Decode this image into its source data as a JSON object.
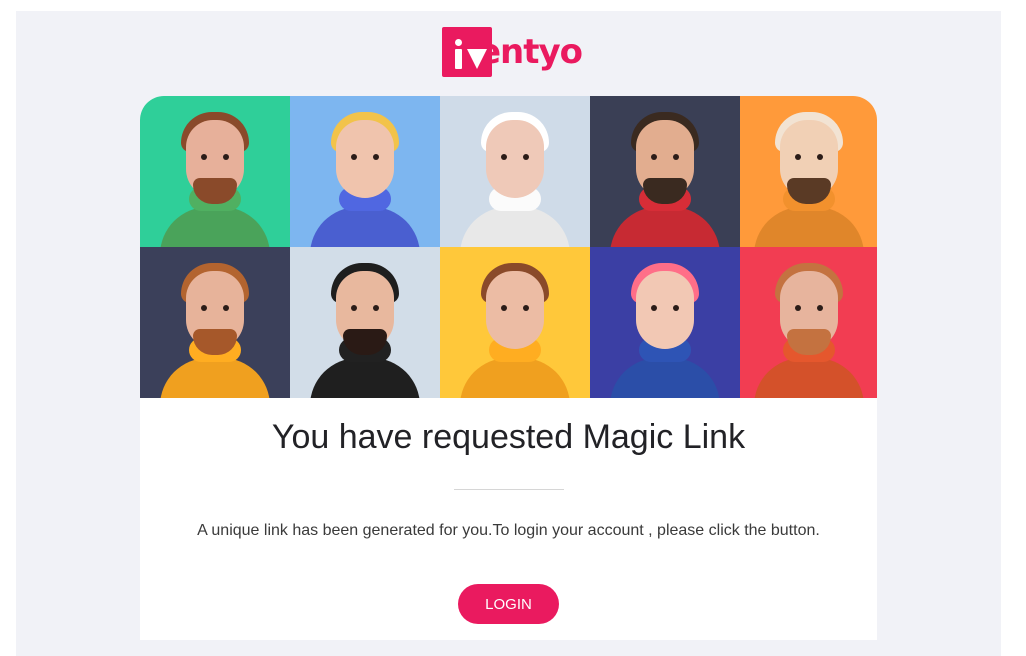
{
  "brand": {
    "name": "iventyo",
    "logo_text": "entyo",
    "accent": "#ea1a5f"
  },
  "hero": {
    "description_hidden": "",
    "avatars": [
      {
        "bg": "#2fcf99",
        "skin": "#e7b09a",
        "hair": "#8a4a2a",
        "shirt": "#4aa35a",
        "beard": "#8a4a2a"
      },
      {
        "bg": "#7db6f0",
        "skin": "#f0c4ad",
        "hair": "#f2c34a",
        "shirt": "#4a5fd0",
        "beard": ""
      },
      {
        "bg": "#cfdbe8",
        "skin": "#efc9b8",
        "hair": "#ffffff",
        "shirt": "#e8e8e8",
        "beard": ""
      },
      {
        "bg": "#3a3f55",
        "skin": "#e2ad8f",
        "hair": "#3a2a20",
        "shirt": "#c72a33",
        "beard": "#3a2a20"
      },
      {
        "bg": "#ff9a3a",
        "skin": "#f1d0b5",
        "hair": "#f2e3d3",
        "shirt": "#e0862a",
        "beard": "#5a3a25"
      },
      {
        "bg": "#3b405a",
        "skin": "#e7b39a",
        "hair": "#b3642f",
        "shirt": "#f0a01f",
        "beard": "#a6582a"
      },
      {
        "bg": "#d2dde8",
        "skin": "#e8b89e",
        "hair": "#1e1e1e",
        "shirt": "#1f1f1f",
        "beard": "#2a1a15"
      },
      {
        "bg": "#ffc83a",
        "skin": "#ecbca4",
        "hair": "#8a4a2a",
        "shirt": "#f0a01f",
        "beard": ""
      },
      {
        "bg": "#3b3fa4",
        "skin": "#f2c8b4",
        "hair": "#ff6e88",
        "shirt": "#2b4ea8",
        "beard": ""
      },
      {
        "bg": "#f23d52",
        "skin": "#e7b49d",
        "hair": "#c47240",
        "shirt": "#d4512a",
        "beard": "#c47240"
      }
    ]
  },
  "main": {
    "title": "You have requested Magic Link",
    "message": "A unique link has been generated for you.To login your account , please click the button.",
    "login_label": "LOGIN"
  }
}
